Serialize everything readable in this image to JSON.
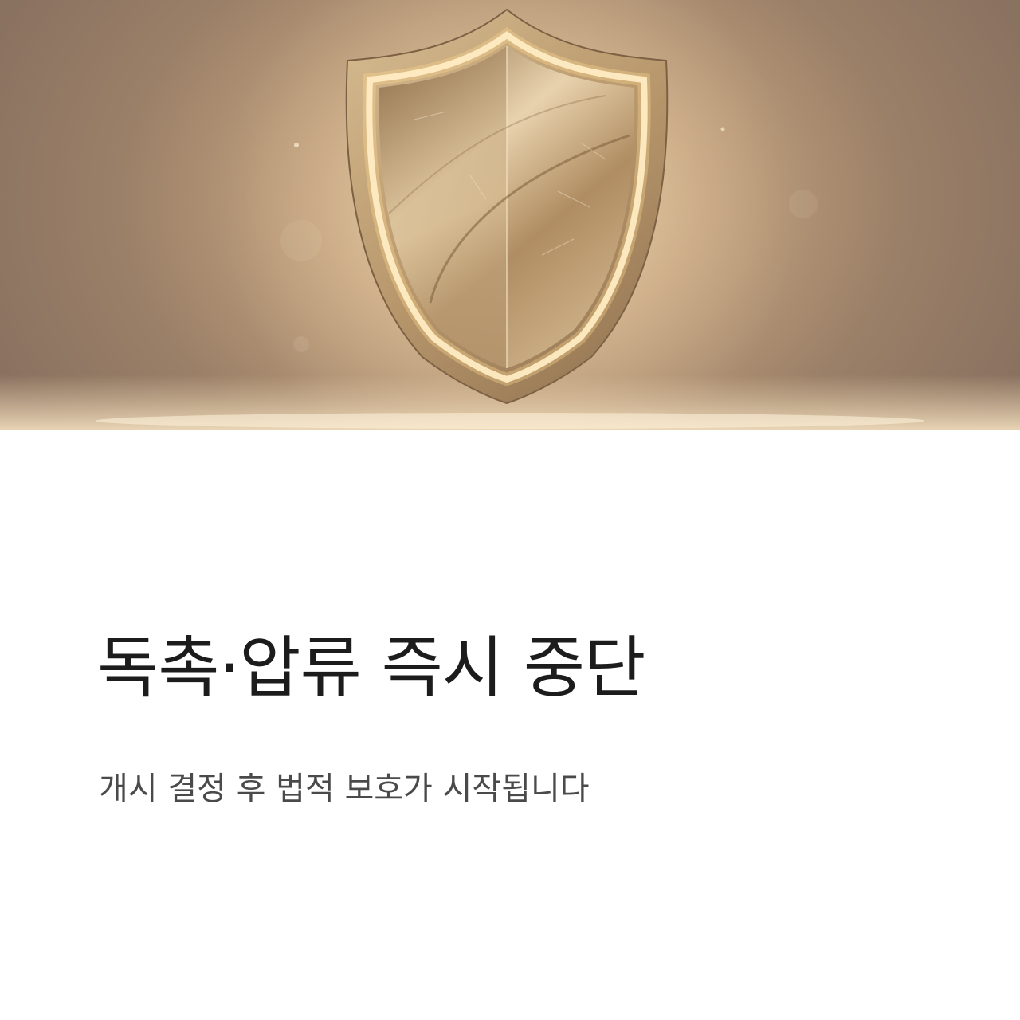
{
  "hero": {
    "illustration": "shield-icon",
    "colors": {
      "background": "#b89a7a",
      "shield_gold": "#c9a878",
      "glow": "#fff3d6"
    }
  },
  "content": {
    "headline": "독촉·압류 즉시 중단",
    "subline": "개시 결정 후 법적 보호가 시작됩니다"
  }
}
